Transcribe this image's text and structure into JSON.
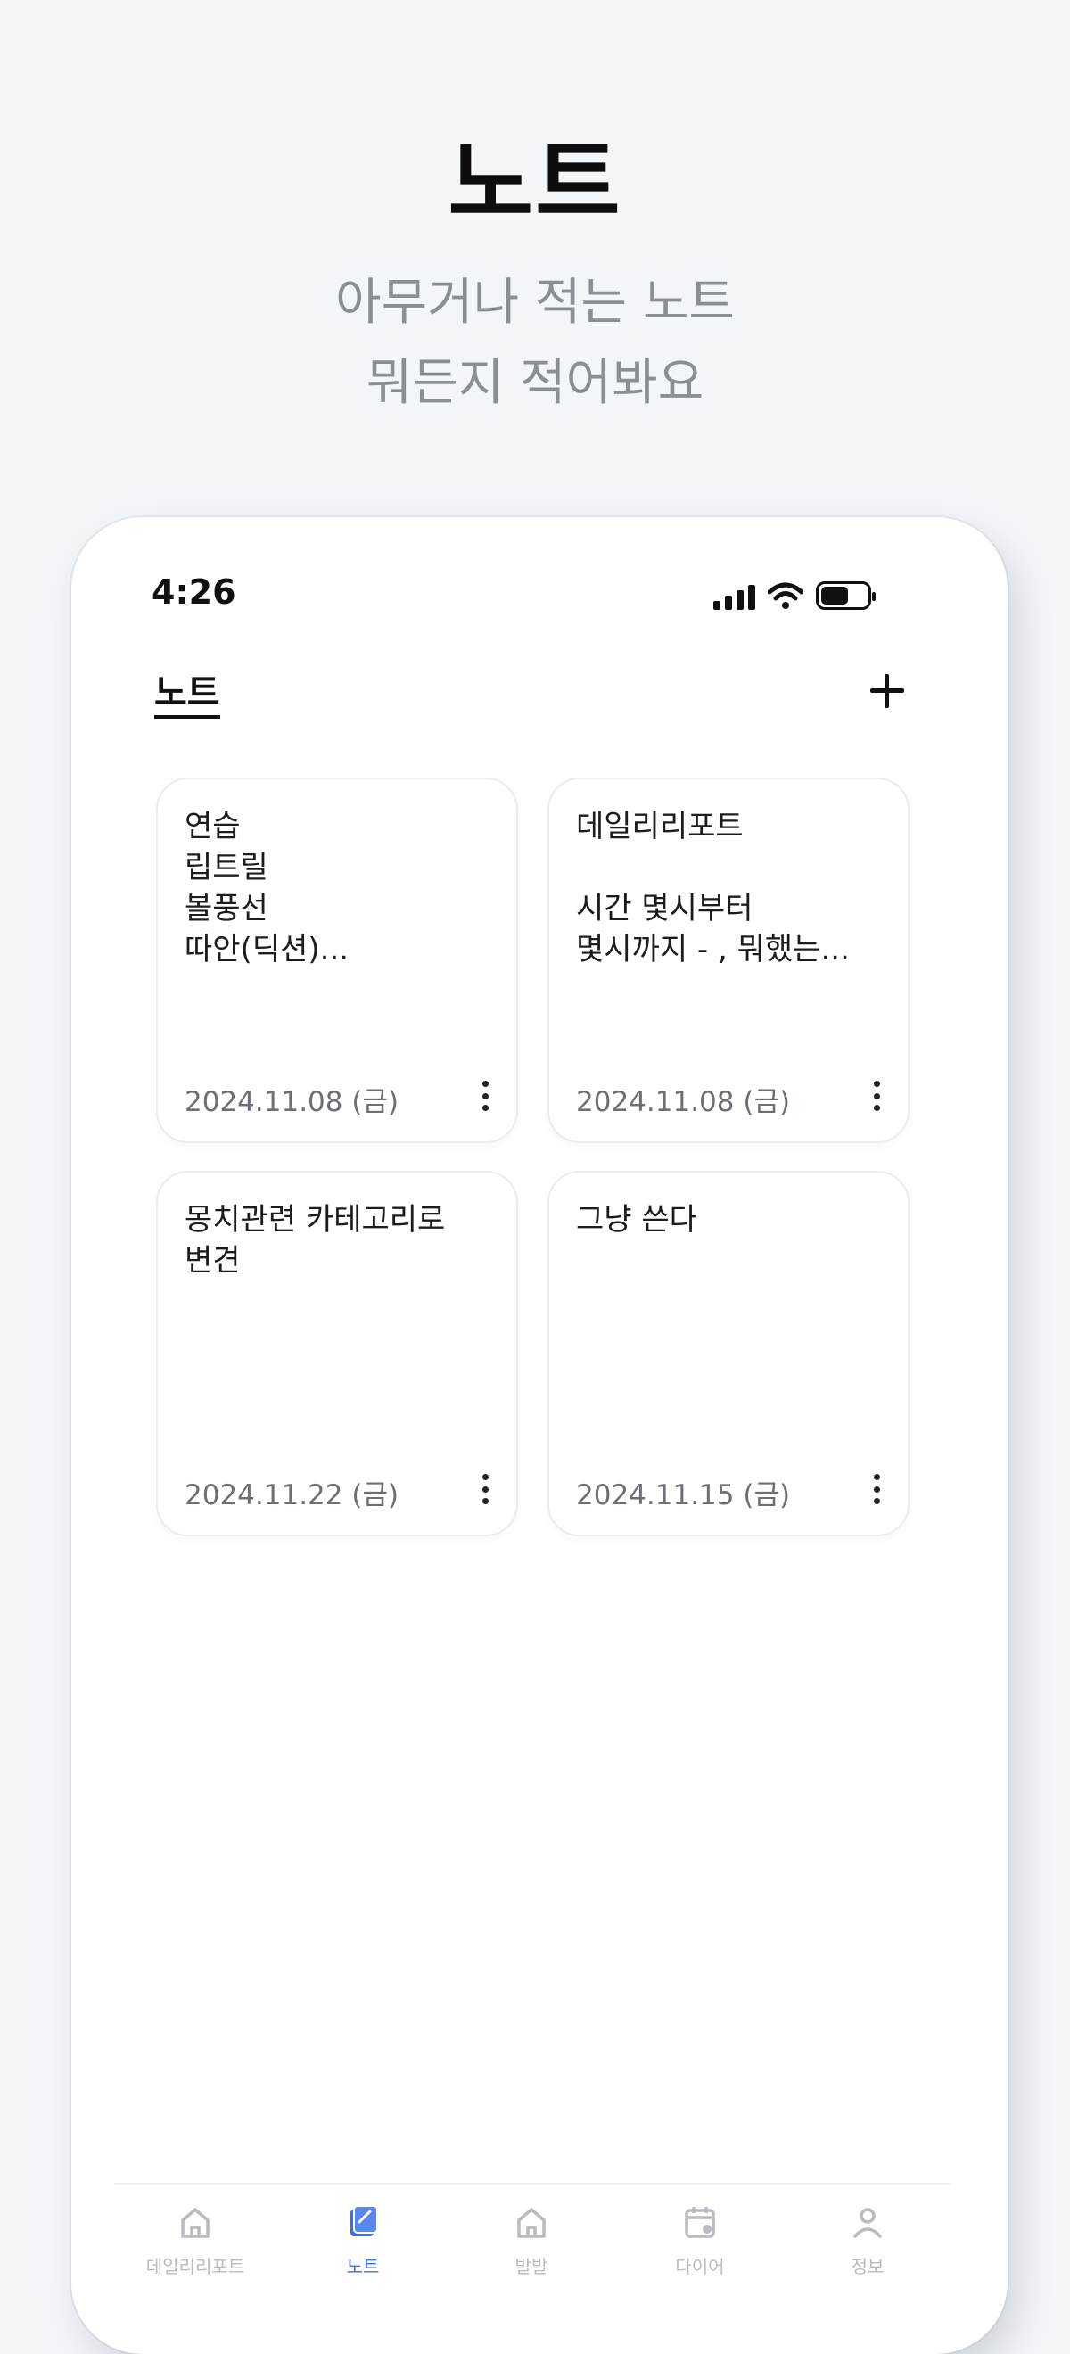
{
  "hero": {
    "title": "노트",
    "subtitle_line1": "아무거나 적는 노트",
    "subtitle_line2": "뭐든지 적어봐요"
  },
  "status_bar": {
    "time": "4:26"
  },
  "header": {
    "title": "노트",
    "add_icon": "plus-icon"
  },
  "notes": [
    {
      "text": "연습\n립트릴\n볼풍선\n따안(딕션)...",
      "date": "2024.11.08 (금)"
    },
    {
      "text": "데일리리포트\n\n시간 몇시부터\n몇시까지 - , 뭐했는...",
      "date": "2024.11.08 (금)"
    },
    {
      "text": "몽치관련 카테고리로\n변견",
      "date": "2024.11.22 (금)"
    },
    {
      "text": "그냥 쓴다",
      "date": "2024.11.15 (금)"
    }
  ],
  "tabbar": {
    "items": [
      {
        "label": "데일리리포트",
        "icon": "home-icon",
        "active": false
      },
      {
        "label": "노트",
        "icon": "note-icon",
        "active": true
      },
      {
        "label": "발발",
        "icon": "home-icon",
        "active": false
      },
      {
        "label": "다이어",
        "icon": "calendar-icon",
        "active": false
      },
      {
        "label": "정보",
        "icon": "user-icon",
        "active": false
      }
    ]
  },
  "colors": {
    "background": "#f3f6f9",
    "accent": "#3d6ee8",
    "inactive": "#b8bcc2"
  }
}
